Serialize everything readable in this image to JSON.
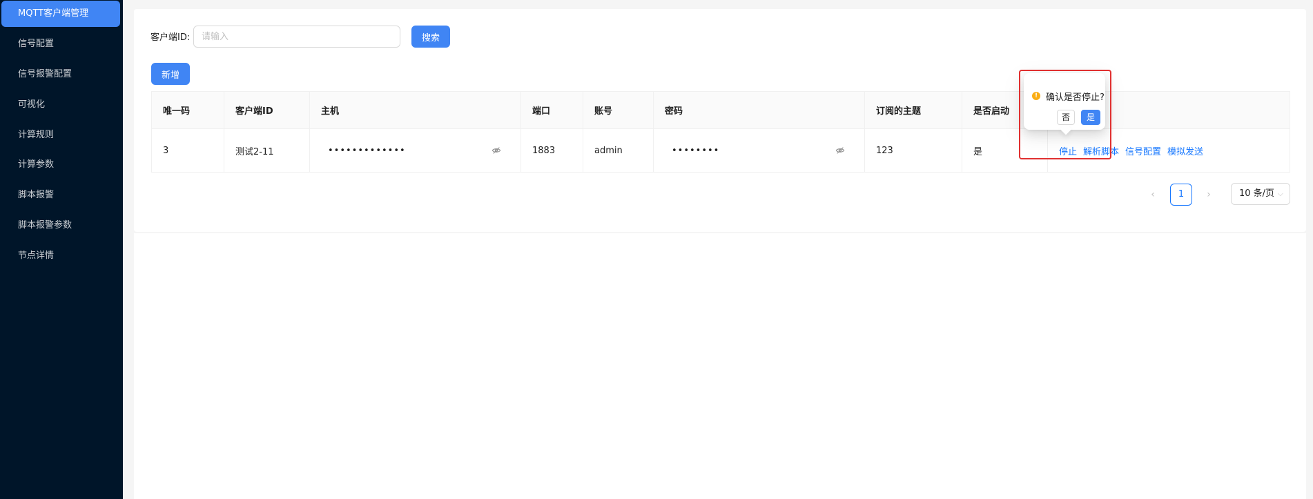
{
  "sidebar": {
    "items": [
      {
        "label": "MQTT客户端管理",
        "active": true
      },
      {
        "label": "信号配置",
        "active": false
      },
      {
        "label": "信号报警配置",
        "active": false
      },
      {
        "label": "可视化",
        "active": false
      },
      {
        "label": "计算规则",
        "active": false
      },
      {
        "label": "计算参数",
        "active": false
      },
      {
        "label": "脚本报警",
        "active": false
      },
      {
        "label": "脚本报警参数",
        "active": false
      },
      {
        "label": "节点详情",
        "active": false
      }
    ]
  },
  "search": {
    "label": "客户端ID:",
    "placeholder": "请输入",
    "value": "",
    "button_label": "搜索"
  },
  "toolbar": {
    "add_label": "新增"
  },
  "table": {
    "columns": [
      "唯一码",
      "客户端ID",
      "主机",
      "端口",
      "账号",
      "密码",
      "订阅的主题",
      "是否启动",
      ""
    ],
    "rows": [
      {
        "id": "3",
        "client_id": "测试2-11",
        "host": "•••••••••••••",
        "port": "1883",
        "account": "admin",
        "password": "••••••••",
        "topic": "123",
        "started": "是",
        "actions": [
          "停止",
          "解析脚本",
          "信号配置",
          "模拟发送"
        ]
      }
    ]
  },
  "pagination": {
    "prev": "‹",
    "next": "›",
    "current_page": "1",
    "page_size": "10 条/页",
    "chevron": "⌵"
  },
  "popconfirm": {
    "icon_glyph": "!",
    "title": "确认是否停止?",
    "cancel_label": "否",
    "ok_label": "是"
  },
  "colors": {
    "sidebar_bg": "#001529",
    "primary": "#4085f4",
    "link": "#1677ff",
    "warning": "#faad14",
    "highlight": "#e03030"
  }
}
